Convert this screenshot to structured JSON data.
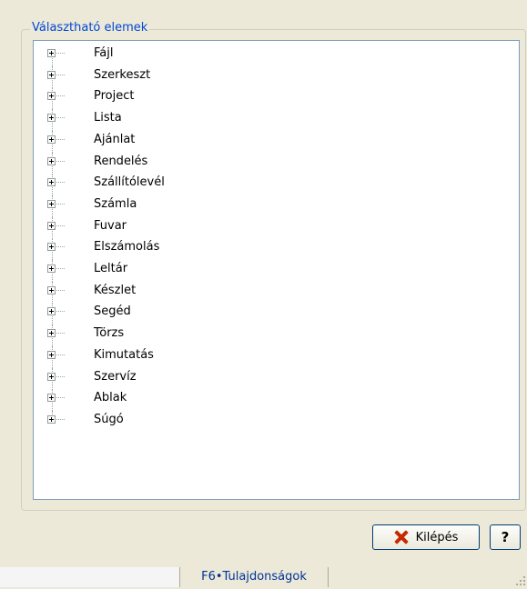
{
  "group": {
    "title": "Választható elemek"
  },
  "tree": {
    "items": [
      {
        "label": "Fájl"
      },
      {
        "label": "Szerkeszt"
      },
      {
        "label": "Project"
      },
      {
        "label": "Lista"
      },
      {
        "label": "Ajánlat"
      },
      {
        "label": "Rendelés"
      },
      {
        "label": "Szállítólevél"
      },
      {
        "label": "Számla"
      },
      {
        "label": "Fuvar"
      },
      {
        "label": "Elszámolás"
      },
      {
        "label": "Leltár"
      },
      {
        "label": "Készlet"
      },
      {
        "label": "Segéd"
      },
      {
        "label": "Törzs"
      },
      {
        "label": "Kimutatás"
      },
      {
        "label": "Szervíz"
      },
      {
        "label": "Ablak"
      },
      {
        "label": "Súgó"
      }
    ]
  },
  "buttons": {
    "exit_label": "Kilépés",
    "help_label": "?"
  },
  "statusbar": {
    "hint": "F6•Tulajdonságok"
  },
  "icons": {
    "exit": "close-x-icon",
    "expander": "plus-box-icon"
  },
  "colors": {
    "title": "#0046d5",
    "status_text": "#003399",
    "exit_icon": "#c62a00"
  }
}
